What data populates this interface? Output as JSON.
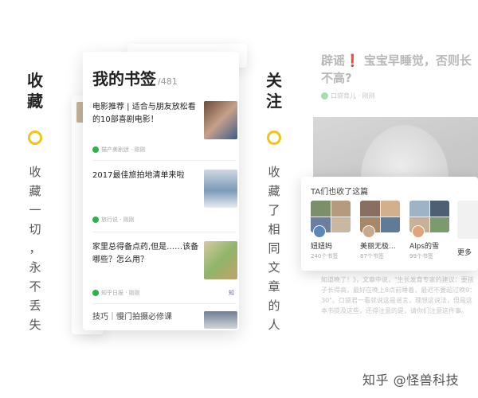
{
  "left_caption": {
    "title": [
      "收",
      "藏"
    ],
    "subtitle": [
      "收",
      "藏",
      "一",
      "切",
      "，",
      "永",
      "不",
      "丢",
      "失"
    ]
  },
  "right_caption": {
    "title": [
      "关",
      "注"
    ],
    "subtitle": [
      "收",
      "藏",
      "了",
      "相",
      "同",
      "文",
      "章",
      "的",
      "人"
    ]
  },
  "bookmarks": {
    "title": "我的书签",
    "count": "/481",
    "items": [
      {
        "text": "电影推荐 | 适合与朋友放松看的10部喜剧电影！",
        "source": "猫产美剧迷 · 刚刚",
        "thumb_colors": [
          "#6b4a3a",
          "#c7a089",
          "#3b5e8a"
        ]
      },
      {
        "text": "2017最佳旅拍地清单来啦",
        "source": "旅行说 · 刚刚",
        "thumb_colors": [
          "#cfd8e4",
          "#7b9ab8",
          "#e8ecf1"
        ]
      },
      {
        "text": "家里总得备点药,但是……该备哪些？怎么用？",
        "source": "知乎日报 · 刚刚",
        "thumb_colors": [
          "#d7c9a2",
          "#8fb56a",
          "#c4a26d"
        ],
        "tag": "知"
      },
      {
        "text": "技巧｜慢门拍摄必修课",
        "source": "",
        "thumb_colors": [
          "#6f7f94",
          "#d0d5dc",
          "#9aa5b1"
        ]
      }
    ]
  },
  "article": {
    "title_a": "辟谣",
    "title_excl": "❗",
    "title_b": " 宝宝早睡觉，否则长不高?",
    "source": "口袋育儿 · 刚刚",
    "body": "知道晚了！》，文章中说，\"生长发育专家的建议：要孩子长得高，最好在晚上8点前睡着，最迟不要超过晚9：30\"。口袋君一看就说这是谣言，理想这说法，但是这本书提及这些，还得注意的是，请你们注意这件事。"
  },
  "popup": {
    "header": "TA们也收了这篇",
    "users": [
      {
        "name": "妞妞妈",
        "count": "240个书签",
        "colors": [
          "#7a8f6a",
          "#b59a7e",
          "#6d7fa0",
          "#c8b7a1"
        ],
        "avatar": "#5b86b8"
      },
      {
        "name": "美丽无极...",
        "count": "87个书签",
        "colors": [
          "#8a6f60",
          "#d2b08e",
          "#a78669",
          "#5f7b95"
        ],
        "avatar": "#c9a88c"
      },
      {
        "name": "Alps的雪",
        "count": "99个书签",
        "colors": [
          "#9fb3c7",
          "#4d5f72",
          "#c7b299",
          "#7d9a6f"
        ],
        "avatar": "#e0a37a"
      }
    ],
    "more": "更多"
  },
  "watermark": "知乎 @怪兽科技",
  "colors": {
    "accent_yellow": "#f3c315",
    "wechat_green": "#2db24a",
    "exclamation_red": "#e53935"
  }
}
